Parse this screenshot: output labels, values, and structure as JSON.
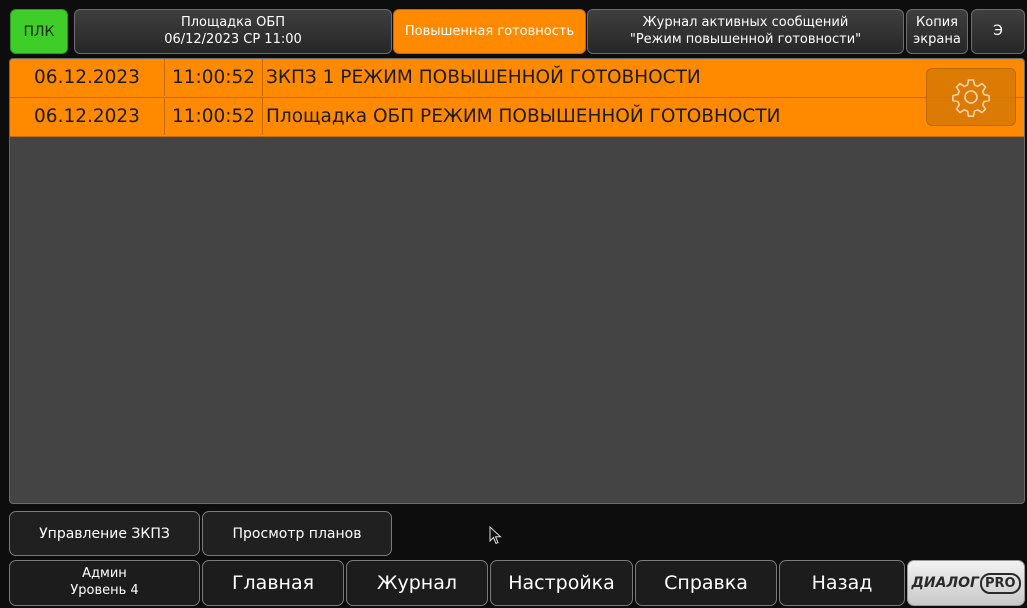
{
  "header": {
    "plc_label": "ПЛК",
    "site_name": "Площадка ОБП",
    "site_datetime": "06/12/2023 СР 11:00",
    "status_label": "Повышенная готовность",
    "journal_title_line1": "Журнал активных сообщений",
    "journal_title_line2": "\"Режим повышенной готовности\"",
    "screenshot_line1": "Копия",
    "screenshot_line2": "экрана",
    "lang_label": "Э"
  },
  "messages": [
    {
      "date": "06.12.2023",
      "time": "11:00:52",
      "text": "ЗКПЗ 1 РЕЖИМ ПОВЫШЕННОЙ ГОТОВНОСТИ"
    },
    {
      "date": "06.12.2023",
      "time": "11:00:52",
      "text": "Площадка ОБП РЕЖИМ ПОВЫШЕННОЙ ГОТОВНОСТИ"
    }
  ],
  "toolbar": {
    "zkpz_control": "Управление ЗКПЗ",
    "view_plans": "Просмотр планов"
  },
  "user": {
    "name": "Админ",
    "level": "Уровень 4"
  },
  "nav": {
    "main": "Главная",
    "journal": "Журнал",
    "settings": "Настройка",
    "help": "Справка",
    "back": "Назад"
  },
  "logo": {
    "text": "ДИАЛОГ",
    "badge": "PRO"
  },
  "colors": {
    "plc_green": "#3fcd2a",
    "alarm_orange": "#ff8a00",
    "panel_grey": "#444444",
    "background": "#0d0d0d"
  }
}
